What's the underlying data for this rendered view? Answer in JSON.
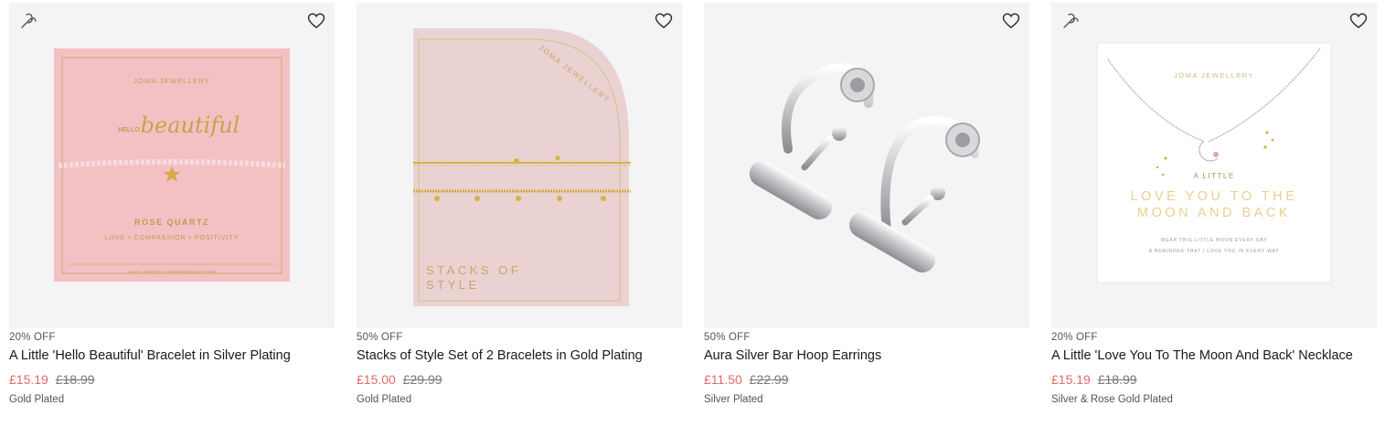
{
  "products": [
    {
      "discount": "20% OFF",
      "name": "A Little 'Hello Beautiful' Bracelet in Silver Plating",
      "price_now": "£15.19",
      "price_was": "£18.99",
      "finish": "Gold Plated",
      "card_text": {
        "brand": "JOMA JEWELLERY",
        "hello": "HELLO",
        "script": "beautiful",
        "stone": "ROSE QUARTZ",
        "tagline": "LOVE • COMPASSION • POSITIVITY",
        "footer": "MADE USING REAL SEMI-PRECIOUS STONE"
      }
    },
    {
      "discount": "50% OFF",
      "name": "Stacks of Style Set of 2 Bracelets in Gold Plating",
      "price_now": "£15.00",
      "price_was": "£29.99",
      "finish": "Gold Plated",
      "card_text": {
        "brand": "JOMA JEWELLERY",
        "title_line1": "STACKS OF",
        "title_line2": "STYLE"
      }
    },
    {
      "discount": "50% OFF",
      "name": "Aura Silver Bar Hoop Earrings",
      "price_now": "£11.50",
      "price_was": "£22.99",
      "finish": "Silver Plated"
    },
    {
      "discount": "20% OFF",
      "name": "A Little 'Love You To The Moon And Back' Necklace",
      "price_now": "£15.19",
      "price_was": "£18.99",
      "finish": "Silver & Rose Gold Plated",
      "card_text": {
        "brand": "JOMA JEWELLERY",
        "a_little": "A LITTLE",
        "line1": "LOVE YOU TO THE",
        "line2": "MOON AND BACK",
        "small1": "WEAR THIS LITTLE MOON EVERY DAY",
        "small2": "A REMINDER THAT I LOVE YOU IN EVERY WAY"
      }
    }
  ],
  "icons": {
    "wishlist": "heart-outline-icon",
    "gift": "gift-ribbon-icon"
  },
  "colors": {
    "sale_price": "#e06a6a",
    "pink_card": "#f4c4c4",
    "gold": "#c9a24a"
  }
}
